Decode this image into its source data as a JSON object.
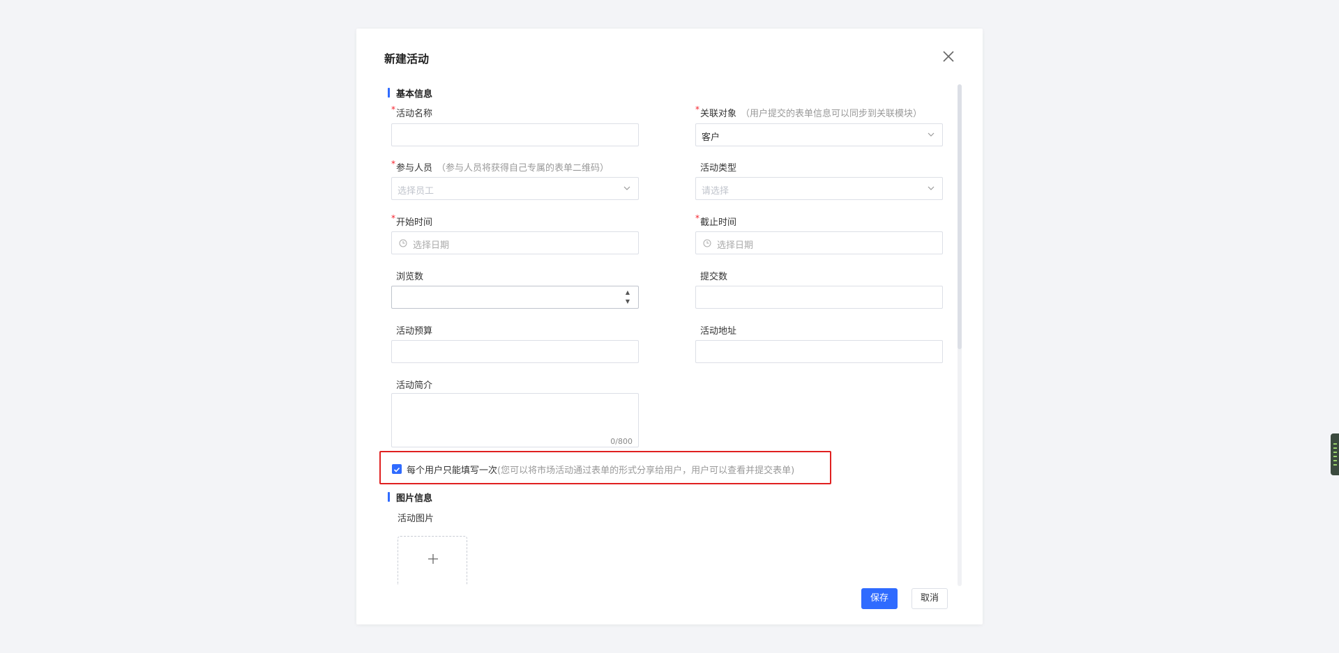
{
  "dialog": {
    "title": "新建活动",
    "close_icon": "close-icon"
  },
  "sections": {
    "basic": "基本信息",
    "image": "图片信息"
  },
  "fields": {
    "activity_name": {
      "label": "活动名称",
      "required": true,
      "value": ""
    },
    "related_object": {
      "label": "关联对象",
      "required": true,
      "hint": "（用户提交的表单信息可以同步到关联模块）",
      "value": "客户"
    },
    "participants": {
      "label": "参与人员",
      "required": true,
      "hint": "（参与人员将获得自己专属的表单二维码）",
      "placeholder": "选择员工"
    },
    "activity_type": {
      "label": "活动类型",
      "required": false,
      "placeholder": "请选择"
    },
    "start_time": {
      "label": "开始时间",
      "required": true,
      "placeholder": "选择日期"
    },
    "end_time": {
      "label": "截止时间",
      "required": true,
      "placeholder": "选择日期"
    },
    "views": {
      "label": "浏览数",
      "value": ""
    },
    "submissions": {
      "label": "提交数",
      "value": ""
    },
    "budget": {
      "label": "活动预算",
      "value": ""
    },
    "address": {
      "label": "活动地址",
      "value": ""
    },
    "intro": {
      "label": "活动简介",
      "value": "",
      "counter": "0/800"
    }
  },
  "once_per_user": {
    "checked": true,
    "label": "每个用户只能填写一次",
    "hint": "(您可以将市场活动通过表单的形式分享给用户，用户可以查看并提交表单)"
  },
  "image": {
    "label": "活动图片"
  },
  "buttons": {
    "save": "保存",
    "cancel": "取消"
  },
  "colors": {
    "primary": "#2f6bff",
    "required": "#f5222d",
    "highlight": "#e02020",
    "background": "#f3f4f7"
  }
}
